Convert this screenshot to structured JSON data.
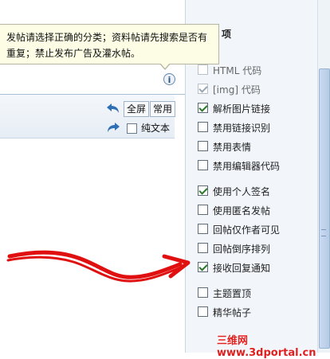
{
  "tooltip": {
    "line1": "发帖请选择正确的分类；资料帖请先搜索是否有",
    "line2": "重复；禁止发布广告及灌水帖。"
  },
  "toolbar": {
    "fullscreen_label": "全屏",
    "common_label": "常用",
    "plain_text_label": "纯文本"
  },
  "options": {
    "title": "项",
    "items": [
      {
        "label": "HTML 代码",
        "checked": false,
        "disabled": true
      },
      {
        "label": "[img] 代码",
        "checked": true,
        "disabled": true
      },
      {
        "label": "解析图片链接",
        "checked": true,
        "disabled": false
      },
      {
        "label": "禁用链接识别",
        "checked": false,
        "disabled": false
      },
      {
        "label": "禁用表情",
        "checked": false,
        "disabled": false
      },
      {
        "label": "禁用编辑器代码",
        "checked": false,
        "disabled": false
      },
      {
        "label": "使用个人签名",
        "checked": true,
        "disabled": false
      },
      {
        "label": "使用匿名发帖",
        "checked": false,
        "disabled": false
      },
      {
        "label": "回帖仅作者可见",
        "checked": false,
        "disabled": false
      },
      {
        "label": "回帖倒序排列",
        "checked": false,
        "disabled": false
      },
      {
        "label": "接收回复通知",
        "checked": true,
        "disabled": false
      },
      {
        "label": "主题置顶",
        "checked": false,
        "disabled": false
      },
      {
        "label": "精华帖子",
        "checked": false,
        "disabled": false
      }
    ]
  },
  "watermark": "三维网www.3dportal.cn",
  "colors": {
    "arrow": "#e01010",
    "watermark": "#e02020",
    "tooltip_bg": "#fdfde6",
    "panel_bg": "#f2f6fb"
  }
}
